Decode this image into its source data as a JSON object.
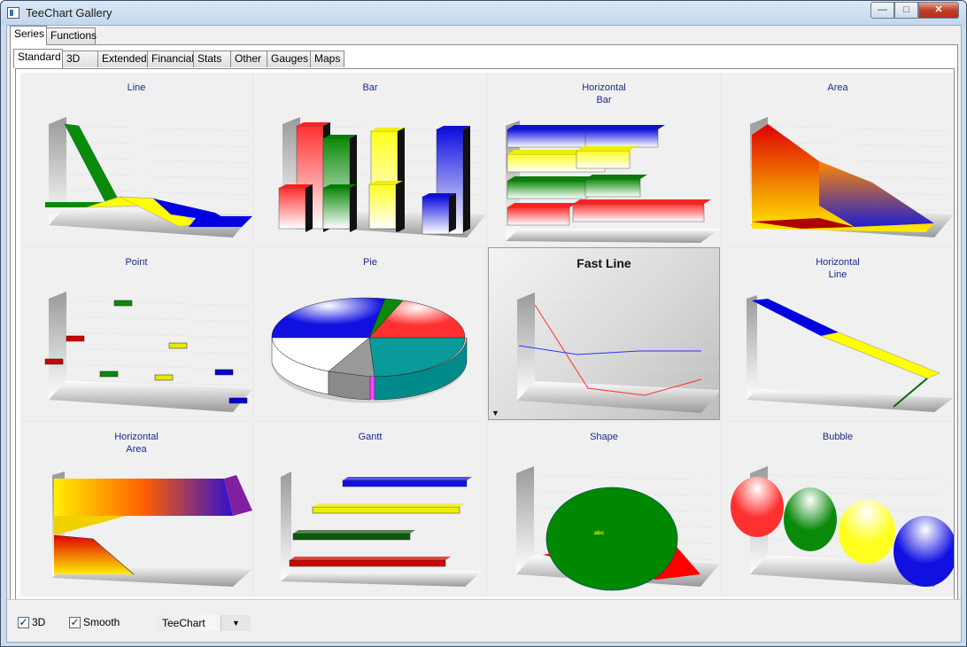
{
  "window": {
    "title": "TeeChart Gallery",
    "minimize": "—",
    "maximize": "□",
    "close": "✕"
  },
  "top_tabs": [
    {
      "label": "Series",
      "active": true
    },
    {
      "label": "Functions",
      "active": false
    }
  ],
  "sub_tabs": [
    {
      "label": "Standard",
      "active": true
    },
    {
      "label": "3D",
      "active": false
    },
    {
      "label": "Extended",
      "active": false
    },
    {
      "label": "Financial",
      "active": false
    },
    {
      "label": "Stats",
      "active": false
    },
    {
      "label": "Other",
      "active": false
    },
    {
      "label": "Gauges",
      "active": false
    },
    {
      "label": "Maps",
      "active": false
    }
  ],
  "gallery": [
    {
      "title": "Line",
      "selected": false
    },
    {
      "title": "Bar",
      "selected": false
    },
    {
      "title": "Horizontal\nBar",
      "selected": false
    },
    {
      "title": "Area",
      "selected": false
    },
    {
      "title": "Point",
      "selected": false
    },
    {
      "title": "Pie",
      "selected": false
    },
    {
      "title": "Fast Line",
      "selected": true
    },
    {
      "title": "Horizontal\nLine",
      "selected": false
    },
    {
      "title": "Horizontal\nArea",
      "selected": false
    },
    {
      "title": "Gantt",
      "selected": false
    },
    {
      "title": "Shape",
      "selected": false
    },
    {
      "title": "Bubble",
      "selected": false
    }
  ],
  "shape_label": "abc",
  "options": {
    "three_d": {
      "label": "3D",
      "checked": true
    },
    "smooth": {
      "label": "Smooth",
      "checked": true
    },
    "style": {
      "value": "TeeChart"
    }
  },
  "colors": {
    "title_text": "#1a2a8f",
    "series": [
      "#e00000",
      "#0a8a0a",
      "#f6f000",
      "#0010e0",
      "#008b8b",
      "#9a9a9a",
      "#ffffff",
      "#ff40ff"
    ]
  }
}
